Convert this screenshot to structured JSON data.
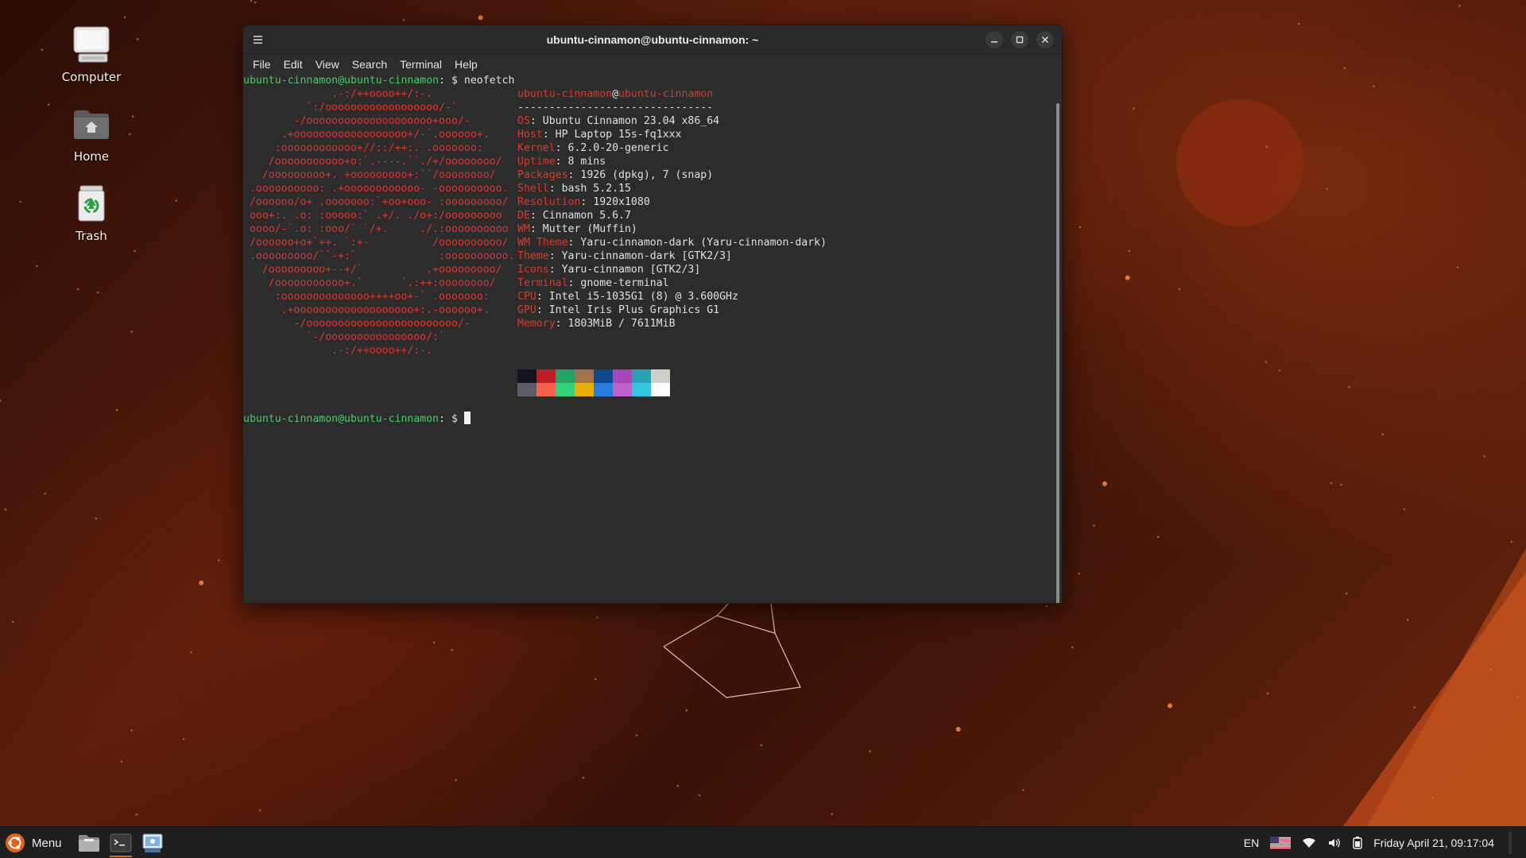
{
  "desktop": {
    "icons": [
      {
        "label": "Computer"
      },
      {
        "label": "Home"
      },
      {
        "label": "Trash"
      }
    ]
  },
  "terminal": {
    "title": "ubuntu-cinnamon@ubuntu-cinnamon: ~",
    "menu": [
      "File",
      "Edit",
      "View",
      "Search",
      "Terminal",
      "Help"
    ],
    "prompt_user": "ubuntu-cinnamon@ubuntu-cinnamon",
    "prompt_suffix": ": $ ",
    "command": "neofetch",
    "ascii": [
      "              .-:/++oooo++/:-.",
      "          `:/oooooooooooooooooo/-`",
      "        -/oooooooooooooooooooo+ooo/-",
      "      .+oooooooooooooooooo+/-`.oooooo+.",
      "     :oooooooooooo+//::/++:. .ooooooo:",
      "    /ooooooooooo+o:`.----.``./+/oooooooo/",
      "   /ooooooooo+. +ooooooooo+:``/oooooooo/",
      " .oooooooooo: .+oooooooooooo- -oooooooooo.",
      " /oooooo/o+ .ooooooo:`+oo+ooo- :ooooooooo/",
      " ooo+:. .o: :ooooo:` .+/. ./o+:/ooooooooo",
      " oooo/-`.o: :ooo/` `/+.     ./.:oooooooooo",
      " /oooooo+o+`++. `:+-          /oooooooooo/",
      " .ooooooooo/``-+:`             :oooooooooo.",
      "   /ooooooooo+--+/`          .+ooooooooo/",
      "    /ooooooooooo+.`      `.:++:oooooooo/",
      "     :oooooooooooooo++++oo+-` .ooooooo:",
      "      .+ooooooooooooooooooo+:.-oooooo+.",
      "        -/oooooooooooooooooooooooo/-",
      "          `-/oooooooooooooooo/:`",
      "              .-:/++oooo++/:-."
    ],
    "info_header_user": "ubuntu-cinnamon",
    "info_header_at": "@",
    "info_header_host": "ubuntu-cinnamon",
    "info_separator": "-------------------------------",
    "info": [
      {
        "key": "OS",
        "value": "Ubuntu Cinnamon 23.04 x86_64"
      },
      {
        "key": "Host",
        "value": "HP Laptop 15s-fq1xxx"
      },
      {
        "key": "Kernel",
        "value": "6.2.0-20-generic"
      },
      {
        "key": "Uptime",
        "value": "8 mins"
      },
      {
        "key": "Packages",
        "value": "1926 (dpkg), 7 (snap)"
      },
      {
        "key": "Shell",
        "value": "bash 5.2.15"
      },
      {
        "key": "Resolution",
        "value": "1920x1080"
      },
      {
        "key": "DE",
        "value": "Cinnamon 5.6.7"
      },
      {
        "key": "WM",
        "value": "Mutter (Muffin)"
      },
      {
        "key": "WM Theme",
        "value": "Yaru-cinnamon-dark (Yaru-cinnamon-dark)"
      },
      {
        "key": "Theme",
        "value": "Yaru-cinnamon-dark [GTK2/3]"
      },
      {
        "key": "Icons",
        "value": "Yaru-cinnamon [GTK2/3]"
      },
      {
        "key": "Terminal",
        "value": "gnome-terminal"
      },
      {
        "key": "CPU",
        "value": "Intel i5-1035G1 (8) @ 3.600GHz"
      },
      {
        "key": "GPU",
        "value": "Intel Iris Plus Graphics G1"
      },
      {
        "key": "Memory",
        "value": "1803MiB / 7611MiB"
      }
    ],
    "palette_top": [
      "#171421",
      "#c01c28",
      "#26a269",
      "#a2734c",
      "#12488b",
      "#a347ba",
      "#2aa1b3",
      "#d0cfcc"
    ],
    "palette_bottom": [
      "#5e5c64",
      "#f66151",
      "#33d17a",
      "#e9ad0c",
      "#2a7bde",
      "#c061cb",
      "#33c7de",
      "#ffffff"
    ]
  },
  "taskbar": {
    "menu_label": "Menu",
    "apps": [
      "file-manager-icon",
      "terminal-icon",
      "system-settings-icon"
    ],
    "keyboard_layout": "EN",
    "clock": "Friday April 21, 09:17:04"
  },
  "colors": {
    "accent": "#e2621c",
    "prompt_green": "#4ec96a",
    "neofetch_red": "#e3342f"
  }
}
